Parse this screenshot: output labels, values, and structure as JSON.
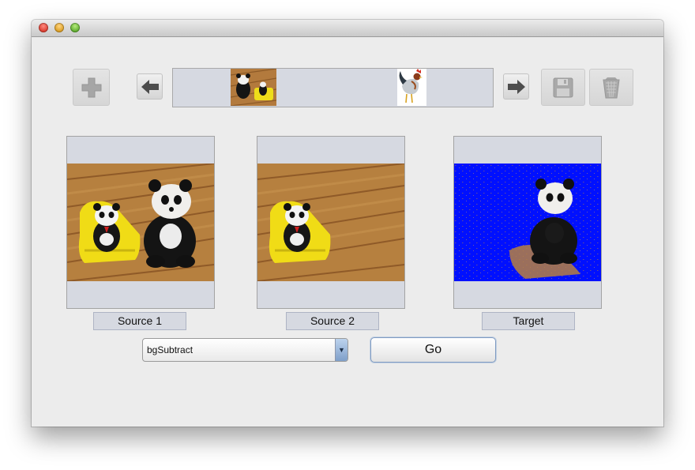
{
  "window": {
    "title": ""
  },
  "toolbar": {
    "add_icon": "plus-icon",
    "prev_icon": "arrow-left-icon",
    "next_icon": "arrow-right-icon",
    "save_icon": "floppy-disk-icon",
    "delete_icon": "trash-icon"
  },
  "thumbnails": [
    "pandas-on-chair",
    "rooster"
  ],
  "panels": [
    {
      "label": "Source 1",
      "image": "two pandas on wooden floor"
    },
    {
      "label": "Source 2",
      "image": "small panda in yellow chair on wooden floor"
    },
    {
      "label": "Target",
      "image": "background-subtracted result on blue"
    }
  ],
  "operation": {
    "selected": "bgSubtract"
  },
  "go_button": {
    "label": "Go"
  },
  "colors": {
    "panel_bg": "#d6d9e1",
    "target_blue": "#0010ff",
    "floor": "#b6803f",
    "chair_yellow": "#f0dc16"
  }
}
